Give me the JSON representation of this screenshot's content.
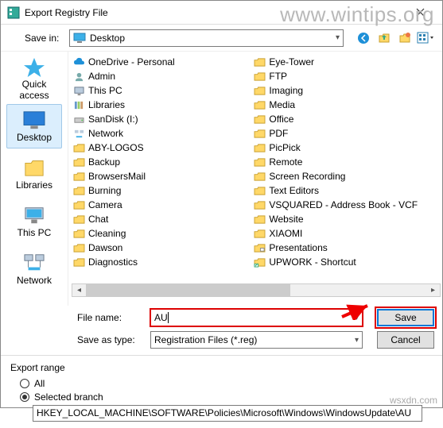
{
  "title": "Export Registry File",
  "watermark": "www.wintips.org",
  "watermark2": "wsxdn.com",
  "savein": {
    "label": "Save in:",
    "value": "Desktop"
  },
  "places": [
    {
      "id": "quick-access",
      "label": "Quick access"
    },
    {
      "id": "desktop",
      "label": "Desktop"
    },
    {
      "id": "libraries",
      "label": "Libraries"
    },
    {
      "id": "this-pc",
      "label": "This PC"
    },
    {
      "id": "network",
      "label": "Network"
    }
  ],
  "files_left": [
    {
      "icon": "cloud",
      "label": "OneDrive - Personal"
    },
    {
      "icon": "user",
      "label": "Admin"
    },
    {
      "icon": "pc",
      "label": "This PC"
    },
    {
      "icon": "lib",
      "label": "Libraries"
    },
    {
      "icon": "drive",
      "label": "SanDisk (I:)"
    },
    {
      "icon": "net",
      "label": "Network"
    },
    {
      "icon": "folder",
      "label": "ABY-LOGOS"
    },
    {
      "icon": "folder",
      "label": "Backup"
    },
    {
      "icon": "folder",
      "label": "BrowsersMail"
    },
    {
      "icon": "folder",
      "label": "Burning"
    },
    {
      "icon": "folder",
      "label": "Camera"
    },
    {
      "icon": "folder",
      "label": "Chat"
    },
    {
      "icon": "folder",
      "label": "Cleaning"
    },
    {
      "icon": "folder",
      "label": "Dawson"
    },
    {
      "icon": "folder",
      "label": "Diagnostics"
    }
  ],
  "files_right": [
    {
      "icon": "folder",
      "label": "Eye-Tower"
    },
    {
      "icon": "folder",
      "label": "FTP"
    },
    {
      "icon": "folder",
      "label": "Imaging"
    },
    {
      "icon": "folder",
      "label": "Media"
    },
    {
      "icon": "folder",
      "label": "Office"
    },
    {
      "icon": "folder",
      "label": "PDF"
    },
    {
      "icon": "folder",
      "label": "PicPick"
    },
    {
      "icon": "folder",
      "label": "Remote"
    },
    {
      "icon": "folder",
      "label": "Screen Recording"
    },
    {
      "icon": "folder",
      "label": "Text Editors"
    },
    {
      "icon": "folder",
      "label": "VSQUARED - Address Book - VCF"
    },
    {
      "icon": "folder",
      "label": "Website"
    },
    {
      "icon": "folder",
      "label": "XIAOMI"
    },
    {
      "icon": "folder-sys",
      "label": "Presentations"
    },
    {
      "icon": "shortcut",
      "label": "UPWORK - Shortcut"
    }
  ],
  "filename": {
    "label": "File name:",
    "value": "AU"
  },
  "savetype": {
    "label": "Save as type:",
    "value": "Registration Files (*.reg)"
  },
  "buttons": {
    "save": "Save",
    "cancel": "Cancel"
  },
  "export_range": {
    "title": "Export range",
    "all": "All",
    "selected": "Selected branch",
    "branch": "HKEY_LOCAL_MACHINE\\SOFTWARE\\Policies\\Microsoft\\Windows\\WindowsUpdate\\AU"
  }
}
